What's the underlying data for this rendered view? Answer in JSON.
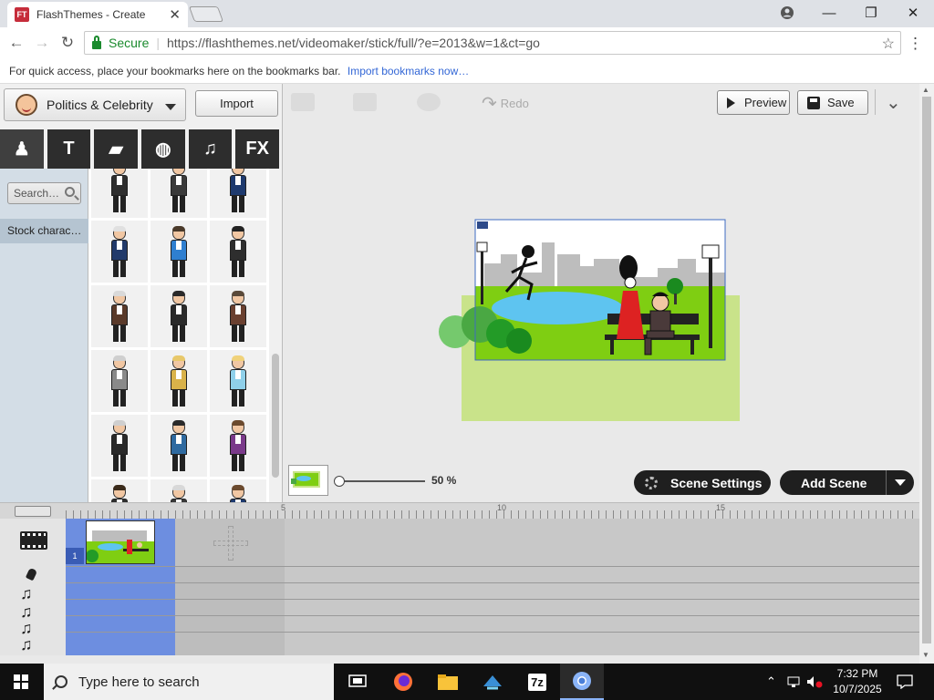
{
  "browser": {
    "tab_title": "FlashThemes - Create",
    "favicon_text": "FT",
    "close_tab": "✕",
    "secure_label": "Secure",
    "url": "https://flashthemes.net/videomaker/stick/full/?e=2013&w=1&ct=go",
    "bookmarks_hint": "For quick access, place your bookmarks here on the bookmarks bar.",
    "bookmarks_link": "Import bookmarks now…",
    "window_controls": [
      "—",
      "❐",
      "✕"
    ]
  },
  "left_panel": {
    "theme_label": "Politics & Celebrity",
    "import_label": "Import",
    "category_tabs": [
      {
        "name": "character-icon",
        "glyph": "♟"
      },
      {
        "name": "text-bubble-icon",
        "glyph": "T"
      },
      {
        "name": "background-icon",
        "glyph": "▰"
      },
      {
        "name": "prop-ball-icon",
        "glyph": "◍"
      },
      {
        "name": "music-note-icon",
        "glyph": "♫"
      },
      {
        "name": "fx-icon",
        "glyph": "FX"
      }
    ],
    "search_placeholder": "Search…",
    "category_item": "Stock charac…",
    "characters": [
      {
        "hair": "#3a2a1a",
        "suit": "#2f2f2f"
      },
      {
        "hair": "#d8d8d8",
        "suit": "#3a3a3a"
      },
      {
        "hair": "#6b4a2e",
        "suit": "#1e3a6e"
      },
      {
        "hair": "#e0e0e0",
        "suit": "#223a6a"
      },
      {
        "hair": "#4a3a2a",
        "suit": "#2f7fd0"
      },
      {
        "hair": "#222222",
        "suit": "#2e2e2e"
      },
      {
        "hair": "#d9d9d9",
        "suit": "#5a3a2a"
      },
      {
        "hair": "#2a2a2a",
        "suit": "#2a2a2a"
      },
      {
        "hair": "#5a4a3a",
        "suit": "#6a4030"
      },
      {
        "hair": "#cfcfcf",
        "suit": "#8a8a8a"
      },
      {
        "hair": "#e8c86a",
        "suit": "#d9b24a"
      },
      {
        "hair": "#f0d27a",
        "suit": "#8fd0ea"
      },
      {
        "hair": "#cfcfcf",
        "suit": "#2a2a2a"
      },
      {
        "hair": "#2a2a2a",
        "suit": "#2f6aa0"
      },
      {
        "hair": "#6b4a2e",
        "suit": "#7a3a8a"
      }
    ]
  },
  "stage_toolbar": {
    "redo_label": "Redo",
    "preview_label": "Preview",
    "save_label": "Save",
    "more_glyph": "⌄"
  },
  "stage_footer": {
    "zoom_label": "50 %",
    "zoom_value": 0.5,
    "scene_settings_label": "Scene Settings",
    "add_scene_label": "Add Scene"
  },
  "timeline": {
    "ruler_labels": [
      "5",
      "10",
      "15"
    ],
    "scene_number": "1",
    "track_icons": [
      "film-icon",
      "mic-icon",
      "music-note-icon",
      "music-note-icon",
      "music-note-icon",
      "music-note-icon"
    ]
  },
  "taskbar": {
    "search_placeholder": "Type here to search",
    "time": "7:32 PM",
    "date": "10/7/2025",
    "apps": [
      "task-view-icon",
      "firefox-icon",
      "file-explorer-icon",
      "vscode-icon",
      "7zip-icon",
      "chrome-icon"
    ],
    "app_7zip_label": "7z"
  }
}
